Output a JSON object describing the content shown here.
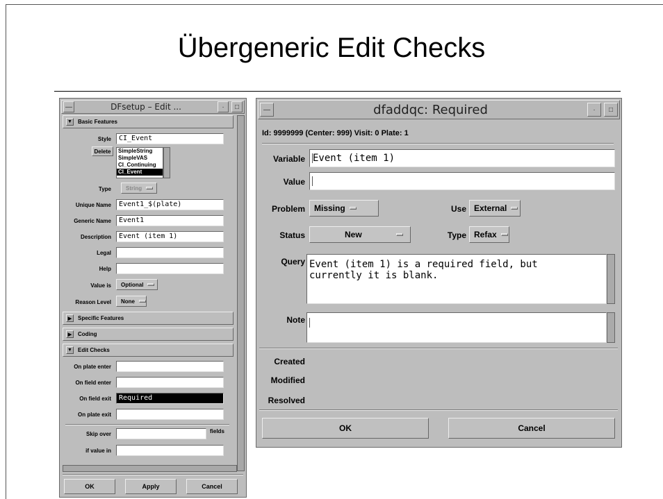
{
  "slide": {
    "title": "Übergeneric Edit Checks"
  },
  "left_window": {
    "title": "DFsetup – Edit ...",
    "sections": {
      "basic": "Basic Features",
      "specific": "Specific Features",
      "coding": "Coding",
      "edit_checks": "Edit Checks"
    },
    "style_label": "Style",
    "style_value": "CI_Event",
    "delete_label": "Delete",
    "style_options": [
      "SimpleString",
      "SimpleVAS",
      "CI_Continuing",
      "CI_Event"
    ],
    "type_label": "Type",
    "type_value": "String",
    "unique_name_label": "Unique Name",
    "unique_name_value": "Event1_$(plate)",
    "generic_name_label": "Generic Name",
    "generic_name_value": "Event1",
    "description_label": "Description",
    "description_value": "Event (item 1)",
    "legal_label": "Legal",
    "help_label": "Help",
    "value_is_label": "Value is",
    "value_is_value": "Optional",
    "reason_level_label": "Reason Level",
    "reason_level_value": "None",
    "on_plate_enter_label": "On plate enter",
    "on_field_enter_label": "On field enter",
    "on_field_exit_label": "On field exit",
    "on_field_exit_value": "Required",
    "on_plate_exit_label": "On plate exit",
    "skip_over_label": "Skip over",
    "fields_label": "fields",
    "if_value_in_label": "if value in",
    "buttons": {
      "ok": "OK",
      "apply": "Apply",
      "cancel": "Cancel"
    }
  },
  "right_window": {
    "title": "dfaddqc: Required",
    "info_line": "Id: 9999999 (Center: 999)  Visit: 0  Plate: 1",
    "variable_label": "Variable",
    "variable_value": "Event (item 1)",
    "value_label": "Value",
    "value_value": "",
    "problem_label": "Problem",
    "problem_value": "Missing",
    "use_label": "Use",
    "use_value": "External",
    "status_label": "Status",
    "status_value": "New",
    "type_label": "Type",
    "type_value": "Refax",
    "query_label": "Query",
    "query_line1": "Event (item 1) is a required field, but",
    "query_line2": "currently it is blank.",
    "note_label": "Note",
    "created_label": "Created",
    "modified_label": "Modified",
    "resolved_label": "Resolved",
    "buttons": {
      "ok": "OK",
      "cancel": "Cancel"
    }
  }
}
